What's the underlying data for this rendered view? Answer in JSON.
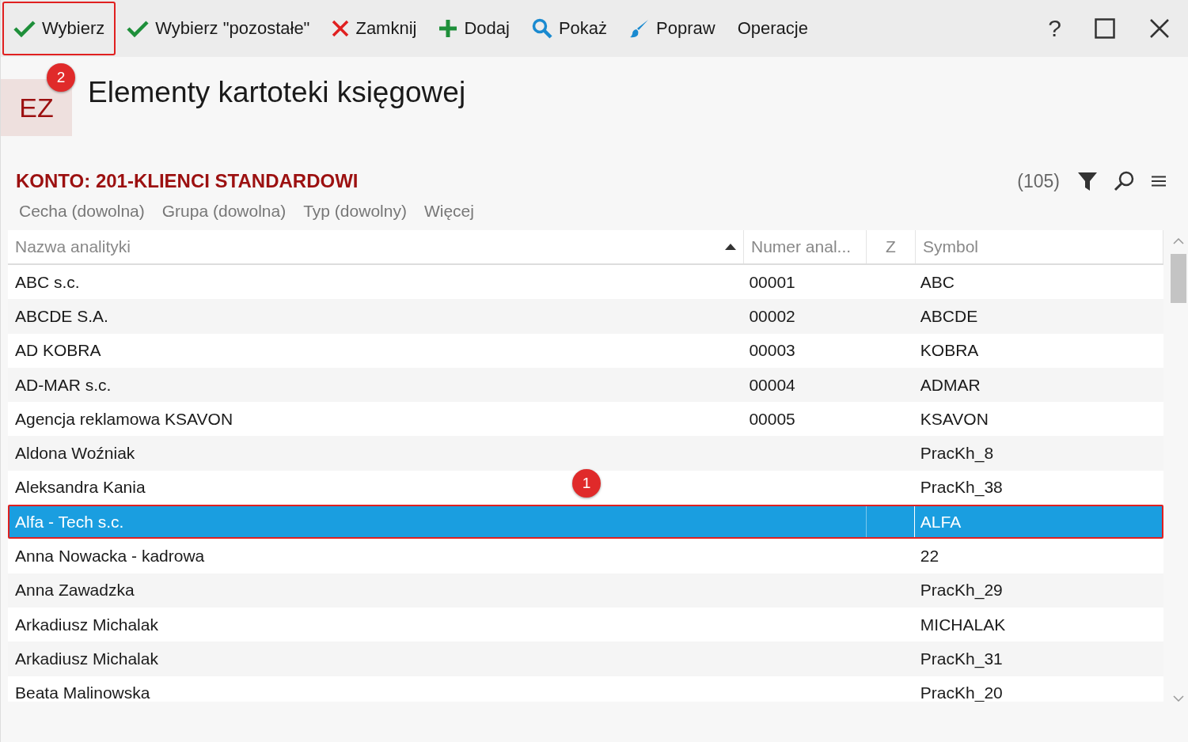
{
  "toolbar": {
    "buttons": [
      {
        "kind": "check",
        "label": "Wybierz",
        "highlighted": true
      },
      {
        "kind": "check",
        "label": "Wybierz \"pozostałe\"",
        "highlighted": false
      },
      {
        "kind": "close",
        "label": "Zamknij",
        "highlighted": false
      },
      {
        "kind": "plus",
        "label": "Dodaj",
        "highlighted": false
      },
      {
        "kind": "search",
        "label": "Pokaż",
        "highlighted": false
      },
      {
        "kind": "brush",
        "label": "Popraw",
        "highlighted": false
      },
      {
        "kind": "none",
        "label": "Operacje",
        "highlighted": false
      }
    ],
    "help": "?"
  },
  "header": {
    "tile": "EZ",
    "badge": "2",
    "title": "Elementy kartoteki księgowej"
  },
  "account": {
    "title": "KONTO: 201-KLIENCI STANDARDOWI",
    "count": "(105)"
  },
  "filters": [
    "Cecha (dowolna)",
    "Grupa (dowolna)",
    "Typ (dowolny)",
    "Więcej"
  ],
  "table": {
    "columns": [
      "Nazwa analityki",
      "Numer anal...",
      "Z",
      "Symbol"
    ],
    "rows": [
      {
        "name": "ABC s.c.",
        "number": "00001",
        "symbol": "ABC",
        "selected": false
      },
      {
        "name": "ABCDE S.A.",
        "number": "00002",
        "symbol": "ABCDE",
        "selected": false
      },
      {
        "name": "AD KOBRA",
        "number": "00003",
        "symbol": "KOBRA",
        "selected": false
      },
      {
        "name": "AD-MAR s.c.",
        "number": "00004",
        "symbol": "ADMAR",
        "selected": false
      },
      {
        "name": "Agencja reklamowa KSAVON",
        "number": "00005",
        "symbol": "KSAVON",
        "selected": false
      },
      {
        "name": "Aldona Woźniak",
        "symbol": "PracKh_8",
        "selected": false
      },
      {
        "name": "Aleksandra Kania",
        "symbol": "PracKh_38",
        "selected": false,
        "badge": "1"
      },
      {
        "name": "Alfa - Tech s.c.",
        "symbol": "ALFA",
        "selected": true
      },
      {
        "name": "Anna Nowacka - kadrowa",
        "symbol": "22",
        "selected": false
      },
      {
        "name": "Anna Zawadzka",
        "symbol": "PracKh_29",
        "selected": false
      },
      {
        "name": "Arkadiusz Michalak",
        "symbol": "MICHALAK",
        "selected": false
      },
      {
        "name": "Arkadiusz Michalak",
        "symbol": "PracKh_31",
        "selected": false
      },
      {
        "name": "Beata Malinowska",
        "symbol": "PracKh_20",
        "selected": false
      }
    ]
  }
}
